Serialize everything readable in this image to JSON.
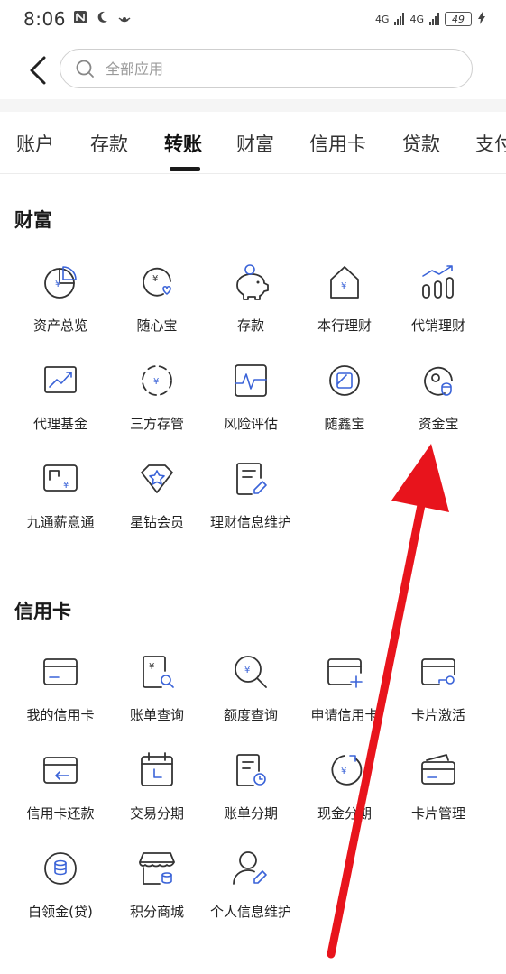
{
  "status_bar": {
    "time": "8:06",
    "signal_1": "4G",
    "signal_2": "4G",
    "battery": "49"
  },
  "header": {
    "search_placeholder": "全部应用"
  },
  "tabs": [
    {
      "label": "账户"
    },
    {
      "label": "存款"
    },
    {
      "label": "转账"
    },
    {
      "label": "财富"
    },
    {
      "label": "信用卡"
    },
    {
      "label": "贷款"
    },
    {
      "label": "支付"
    }
  ],
  "active_tab": "转账",
  "wealth": {
    "title": "财富",
    "items": [
      {
        "label": "资产总览",
        "icon": "pie-chart-yen-icon"
      },
      {
        "label": "随心宝",
        "icon": "yen-heart-icon"
      },
      {
        "label": "存款",
        "icon": "piggy-bank-icon"
      },
      {
        "label": "本行理财",
        "icon": "house-yen-icon"
      },
      {
        "label": "代销理财",
        "icon": "growth-bars-icon"
      },
      {
        "label": "代理基金",
        "icon": "trend-chart-icon"
      },
      {
        "label": "三方存管",
        "icon": "dashed-circle-yen-icon"
      },
      {
        "label": "风险评估",
        "icon": "pulse-monitor-icon"
      },
      {
        "label": "随鑫宝",
        "icon": "square-circle-icon"
      },
      {
        "label": "资金宝",
        "icon": "circle-cup-icon"
      },
      {
        "label": "九通薪意通",
        "icon": "card-yen-icon"
      },
      {
        "label": "星钻会员",
        "icon": "diamond-star-icon"
      },
      {
        "label": "理财信息维护",
        "icon": "document-edit-icon"
      }
    ]
  },
  "credit": {
    "title": "信用卡",
    "items": [
      {
        "label": "我的信用卡",
        "icon": "credit-card-icon"
      },
      {
        "label": "账单查询",
        "icon": "bill-search-icon"
      },
      {
        "label": "额度查询",
        "icon": "yen-magnifier-icon"
      },
      {
        "label": "申请信用卡",
        "icon": "card-plus-icon"
      },
      {
        "label": "卡片激活",
        "icon": "card-key-icon"
      },
      {
        "label": "信用卡还款",
        "icon": "card-return-icon"
      },
      {
        "label": "交易分期",
        "icon": "calendar-icon"
      },
      {
        "label": "账单分期",
        "icon": "bill-clock-icon"
      },
      {
        "label": "现金分期",
        "icon": "yen-coin-icon"
      },
      {
        "label": "卡片管理",
        "icon": "cards-stack-icon"
      },
      {
        "label": "白领金(贷)",
        "icon": "coin-stack-icon"
      },
      {
        "label": "积分商城",
        "icon": "shop-icon"
      },
      {
        "label": "个人信息维护",
        "icon": "person-edit-icon"
      }
    ]
  },
  "colors": {
    "accent": "#3a63d8",
    "annotation": "#e8141c"
  }
}
